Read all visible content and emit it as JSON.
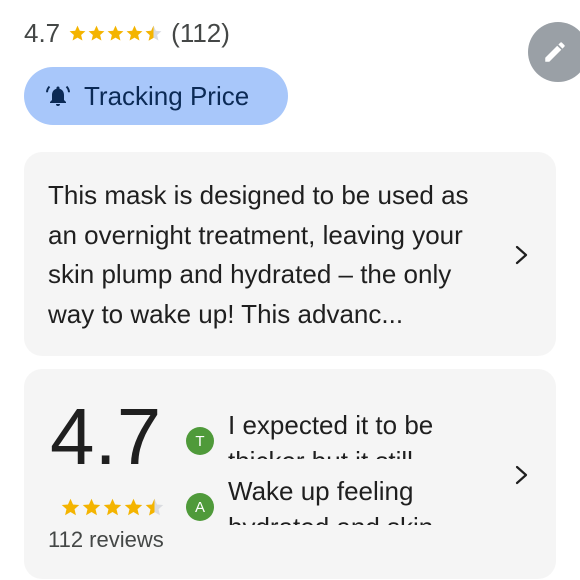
{
  "header": {
    "rating": "4.7",
    "stars": 4.5,
    "review_count": "(112)"
  },
  "icons": {
    "edit": "pencil-icon",
    "bell": "bell-icon",
    "chevron": "chevron-right-icon",
    "star": "star-icon"
  },
  "colors": {
    "star": "#f4b400",
    "chip_background": "#a8c7fa",
    "card_background": "#f5f5f5",
    "avatar": "#4f9a3a",
    "edit_button": "#9aa0a6"
  },
  "tracking": {
    "label": "Tracking Price"
  },
  "description": {
    "text": "This mask is designed to be used as an overnight treatment, leaving your skin plump and hydrated – the only way to wake up! This advanc..."
  },
  "reviews": {
    "rating": "4.7",
    "stars": 4.5,
    "count_label": "112 reviews",
    "snippets": [
      {
        "initial": "T",
        "text": "I expected it to be thicker but it still"
      },
      {
        "initial": "A",
        "text": "Wake up feeling hydrated and skin"
      }
    ]
  }
}
